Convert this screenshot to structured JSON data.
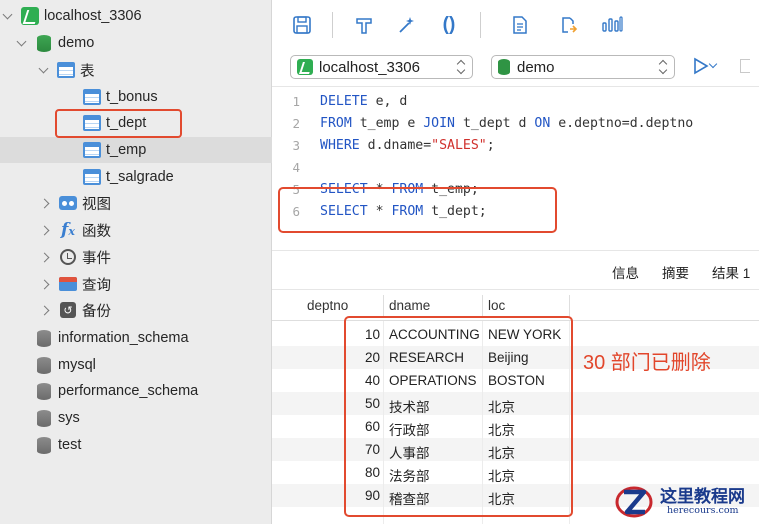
{
  "sidebar": {
    "connection": "localhost_3306",
    "database": "demo",
    "tables_group": "表",
    "tables": [
      "t_bonus",
      "t_dept",
      "t_emp",
      "t_salgrade"
    ],
    "views": "视图",
    "functions": "函数",
    "events": "事件",
    "queries": "查询",
    "backups": "备份",
    "other_dbs": [
      "information_schema",
      "mysql",
      "performance_schema",
      "sys",
      "test"
    ]
  },
  "toolbar": {
    "icons": [
      "save-icon",
      "format-icon",
      "magic-wand-icon",
      "parentheses-icon",
      "document-icon",
      "export-icon",
      "explain-icon"
    ]
  },
  "selectors": {
    "connection": "localhost_3306",
    "database": "demo"
  },
  "editor": {
    "line_numbers": [
      "1",
      "2",
      "3",
      "4",
      "5",
      "6"
    ],
    "lines": [
      [
        {
          "t": "kw",
          "v": "DELETE"
        },
        {
          "t": "pl",
          "v": " e, d"
        }
      ],
      [
        {
          "t": "kw",
          "v": "FROM"
        },
        {
          "t": "pl",
          "v": " t_emp e "
        },
        {
          "t": "kw",
          "v": "JOIN"
        },
        {
          "t": "pl",
          "v": " t_dept d "
        },
        {
          "t": "kw",
          "v": "ON"
        },
        {
          "t": "pl",
          "v": " e.deptno=d.deptno"
        }
      ],
      [
        {
          "t": "kw",
          "v": "WHERE"
        },
        {
          "t": "pl",
          "v": " d.dname="
        },
        {
          "t": "str",
          "v": "\"SALES\""
        },
        {
          "t": "pl",
          "v": ";"
        }
      ],
      [],
      [
        {
          "t": "kw",
          "v": "SELECT"
        },
        {
          "t": "pl",
          "v": " * "
        },
        {
          "t": "kw",
          "v": "FROM"
        },
        {
          "t": "pl",
          "v": " t_emp;"
        }
      ],
      [
        {
          "t": "kw",
          "v": "SELECT"
        },
        {
          "t": "pl",
          "v": " * "
        },
        {
          "t": "kw",
          "v": "FROM"
        },
        {
          "t": "pl",
          "v": " t_dept;"
        }
      ]
    ]
  },
  "result_tabs": [
    "信息",
    "摘要",
    "结果 1"
  ],
  "grid": {
    "columns": [
      "deptno",
      "dname",
      "loc"
    ],
    "rows": [
      [
        "10",
        "ACCOUNTING",
        "NEW YORK"
      ],
      [
        "20",
        "RESEARCH",
        "Beijing"
      ],
      [
        "40",
        "OPERATIONS",
        "BOSTON"
      ],
      [
        "50",
        "技术部",
        "北京"
      ],
      [
        "60",
        "行政部",
        "北京"
      ],
      [
        "70",
        "人事部",
        "北京"
      ],
      [
        "80",
        "法务部",
        "北京"
      ],
      [
        "90",
        "稽查部",
        "北京"
      ]
    ]
  },
  "annotation": "30 部门已删除",
  "watermark": {
    "title": "这里教程网",
    "subtitle": "herecours.com"
  },
  "colors": {
    "highlight_red": "#e24a2f",
    "keyword_blue": "#2255c4",
    "string_red": "#d0312d",
    "sidebar_bg": "#ececec"
  }
}
